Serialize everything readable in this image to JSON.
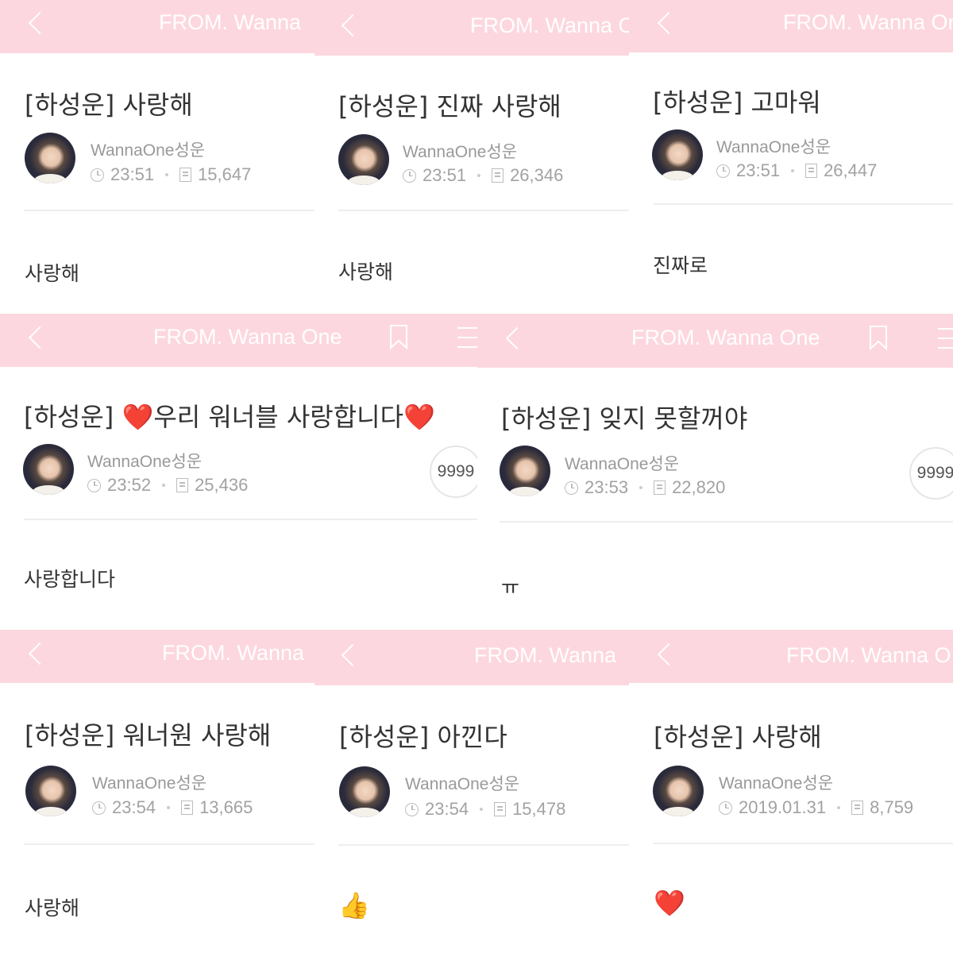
{
  "colors": {
    "header_pink": "#fdd7df",
    "heart_red": "#e3262d"
  },
  "posts": [
    {
      "header_title": "FROM. Wanna",
      "title": "[하성운] 사랑해",
      "author": "WannaOne성운",
      "time": "23:51",
      "views": "15,647",
      "body": "사랑해"
    },
    {
      "header_title": "FROM. Wanna O",
      "title": "[하성운] 진짜 사랑해",
      "author": "WannaOne성운",
      "time": "23:51",
      "views": "26,346",
      "body": "사랑해"
    },
    {
      "header_title": "FROM. Wanna On",
      "title": "[하성운] 고마워",
      "author": "WannaOne성운",
      "time": "23:51",
      "views": "26,447",
      "body": "진짜로"
    },
    {
      "header_title": "FROM. Wanna One",
      "title_prefix": "[하성운] ",
      "title_heart_left": "❤️",
      "title_text": "우리 워너블 사랑합니다",
      "title_heart_right": "❤️",
      "author": "WannaOne성운",
      "time": "23:52",
      "views": "25,436",
      "circle_count": "9999",
      "body": "사랑합니다"
    },
    {
      "header_title": "FROM. Wanna One",
      "title": "[하성운] 잊지 못할꺼야",
      "author": "WannaOne성운",
      "time": "23:53",
      "views": "22,820",
      "circle_count": "9999",
      "body": "ㅠ"
    },
    {
      "header_title": "FROM. Wanna",
      "title": "[하성운] 워너원 사랑해",
      "author": "WannaOne성운",
      "time": "23:54",
      "views": "13,665",
      "body": "사랑해"
    },
    {
      "header_title": "FROM. Wanna",
      "title": "[하성운] 아낀다",
      "author": "WannaOne성운",
      "time": "23:54",
      "views": "15,478",
      "body": "👍"
    },
    {
      "header_title": "FROM. Wanna O",
      "title": "[하성운] 사랑해",
      "author": "WannaOne성운",
      "date": "2019.01.31",
      "views": "8,759",
      "body": "❤️"
    }
  ]
}
